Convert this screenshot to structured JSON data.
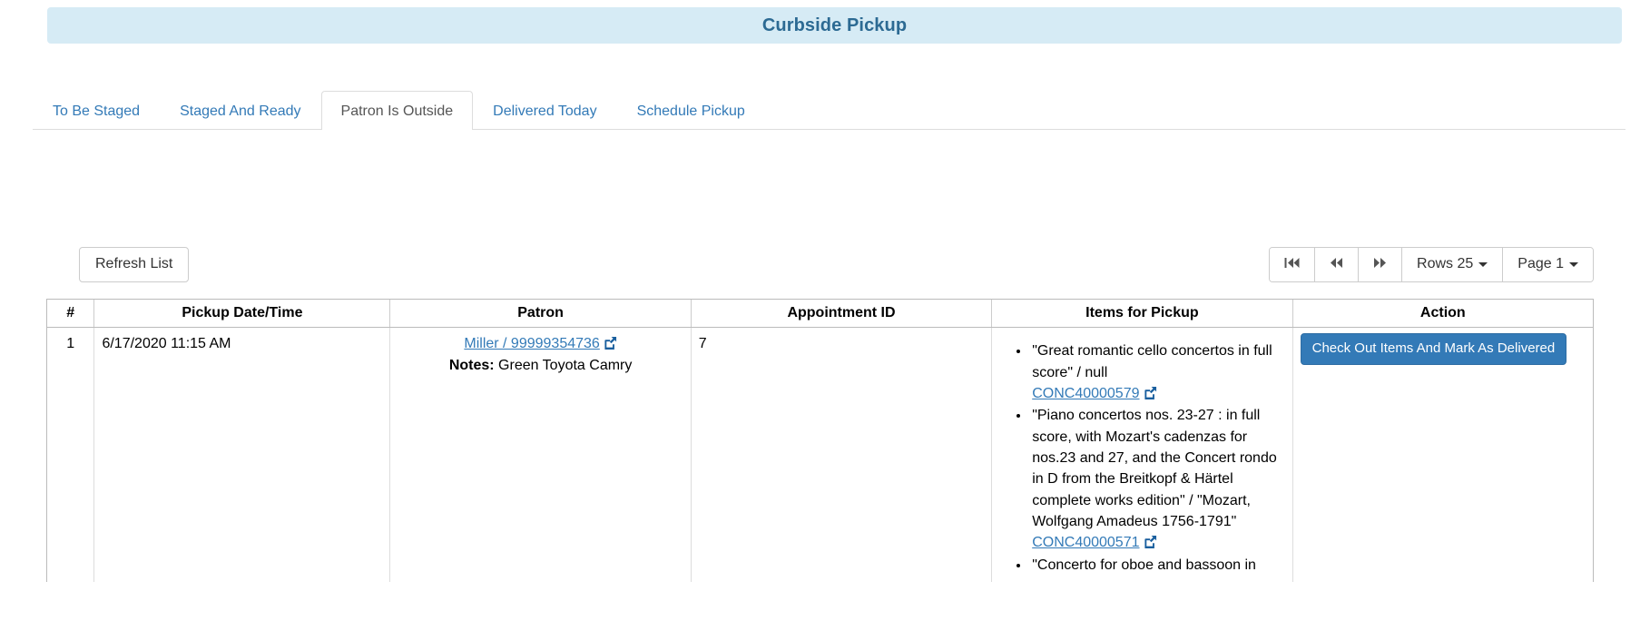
{
  "header": {
    "title": "Curbside Pickup"
  },
  "tabs": [
    {
      "label": "To Be Staged",
      "active": false
    },
    {
      "label": "Staged And Ready",
      "active": false
    },
    {
      "label": "Patron Is Outside",
      "active": true
    },
    {
      "label": "Delivered Today",
      "active": false
    },
    {
      "label": "Schedule Pickup",
      "active": false
    }
  ],
  "toolbar": {
    "refresh_label": "Refresh List",
    "pager": {
      "first_glyph": "◀◀|",
      "prev_glyph": "◀◀",
      "next_glyph": "▶▶",
      "rows_label": "Rows 25",
      "page_label": "Page 1"
    }
  },
  "table": {
    "columns": [
      "#",
      "Pickup Date/Time",
      "Patron",
      "Appointment ID",
      "Items for Pickup",
      "Action"
    ],
    "rows": [
      {
        "num": "1",
        "pickup_datetime": "6/17/2020 11:15 AM",
        "patron_link": "Miller / 99999354736",
        "notes_label": "Notes:",
        "notes_value": "Green Toyota Camry",
        "appointment_id": "7",
        "items": [
          {
            "title": "\"Great romantic cello concertos in full score\" / null",
            "barcode": "CONC40000579"
          },
          {
            "title": "\"Piano concertos nos. 23-27 : in full score, with Mozart's cadenzas for nos.23 and 27, and the Concert rondo in D from the Breitkopf & Härtel complete works edition\" / \"Mozart, Wolfgang Amadeus 1756-1791\"",
            "barcode": "CONC40000571"
          },
          {
            "title": "\"Concerto for oboe and bassoon in",
            "barcode": ""
          }
        ],
        "action_label": "Check Out Items And Mark As Delivered"
      }
    ]
  },
  "colors": {
    "banner_bg": "#d6ebf5",
    "banner_text": "#2c6a93",
    "link": "#337ab7",
    "primary_button": "#337ab7"
  }
}
